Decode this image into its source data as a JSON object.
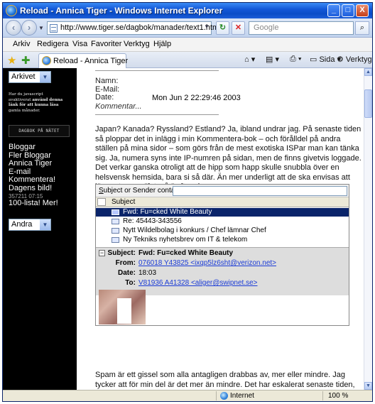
{
  "window": {
    "title": "Reload - Annica Tiger - Windows Internet Explorer",
    "min_label": "_",
    "max_label": "□",
    "close_label": "X"
  },
  "address": {
    "url": "http://www.tiger.se/dagbok/manader/text1.html",
    "search_placeholder": "Google"
  },
  "menu": [
    "Arkiv",
    "Redigera",
    "Visa",
    "Favoriter",
    "Verktyg",
    "Hjälp"
  ],
  "tab": {
    "label": "Reload - Annica Tiger"
  },
  "commands": {
    "page": "Sida",
    "tools": "Verktyg"
  },
  "sidebar": {
    "archive_select": "Arkivet",
    "js_note": [
      "Har du javascript",
      "avaktiverat",
      "använd denna",
      "länk för att kunna läsa",
      "gamla månader."
    ],
    "dagbok_banner": "DAGBOK PÅ NÄTET",
    "links": [
      "Bloggar",
      "Fler Bloggar",
      "Annica Tiger",
      "E-mail",
      "Kommentera!",
      "Dagens bild!"
    ],
    "counter": "357211 07:15",
    "top_link": "100-lista! Mer!",
    "other_select": "Andra"
  },
  "entry": {
    "name_label": "Namn:",
    "email_label": "E-Mail:",
    "date_label": "Date:",
    "date_value": "Mon Jun 2 22:29:46 2003",
    "comment_label": "Kommentar...",
    "para1": "Japan? Kanada? Ryssland? Estland? Ja, ibland undrar jag. På senaste tiden så ploppar det in inlägg i min Kommentera-bok – och förålldel på andra ställen på mina sidor – som görs från de mest exotiska ISPar man kan tänka sig. Ja, numera syns inte IP-numren på sidan, men de finns givetvis loggade. Det verkar ganska otroligt att de hipp som happ skulle snubbla över en helsvensk hemsida, bara si så där. Än mer underligt att de ska envisas att lämna tomma \"fotspår\" efter sig.",
    "para2": "Spam är ett gissel som alla antagligen drabbas av, mer eller mindre. Jag tycker att för min del är det mer än mindre. Det har eskalerat senaste tiden, av någon underlig"
  },
  "mail": {
    "filter_label": "Subject or Sender contains:",
    "filter_u": "S",
    "filter_rest": "ubject or Sender contains:",
    "column_subject": "Subject",
    "rows": [
      "Fwd: Fu=cked White Beauty",
      "Re: 45443-343556",
      "Nytt Wildelbolag i konkurs / Chef lämnar Chef",
      "Ny Tekniks nyhetsbrev om IT & telekom"
    ],
    "preview": {
      "subject_label": "Subject:",
      "subject_value": "Fwd: Fu=cked White Beauty",
      "from_label": "From:",
      "from_value": "076018 Y43825 <ixqp5lz6sht@verizon.net>",
      "date_label": "Date:",
      "date_value": "18:03",
      "to_label": "To:",
      "to_value": "V81936 A41328 <aliger@swipnet.se>"
    }
  },
  "status": {
    "zone": "Internet",
    "zoom": "100 %"
  }
}
